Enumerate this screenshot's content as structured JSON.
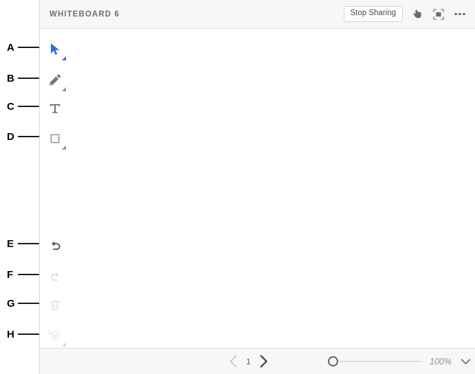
{
  "header": {
    "title": "WHITEBOARD 6",
    "stop_sharing_label": "Stop Sharing",
    "icons": {
      "pointer_hand": "hand-pointer-icon",
      "fit_screen": "fit-to-screen-icon",
      "overflow_menu": "more-options-icon"
    }
  },
  "annotations": [
    {
      "letter": "A",
      "target": "selection-tool"
    },
    {
      "letter": "B",
      "target": "pencil-tool"
    },
    {
      "letter": "C",
      "target": "text-tool"
    },
    {
      "letter": "D",
      "target": "shape-tool"
    },
    {
      "letter": "E",
      "target": "undo-button"
    },
    {
      "letter": "F",
      "target": "redo-button"
    },
    {
      "letter": "G",
      "target": "delete-button"
    },
    {
      "letter": "H",
      "target": "layers-button"
    }
  ],
  "toolbar": {
    "tools": [
      {
        "name": "selection-tool",
        "icon": "cursor-arrow-icon",
        "state": "active",
        "has_flyout": true
      },
      {
        "name": "pencil-tool",
        "icon": "pencil-icon",
        "state": "enabled",
        "has_flyout": true
      },
      {
        "name": "text-tool",
        "icon": "text-t-icon",
        "state": "enabled",
        "has_flyout": false
      },
      {
        "name": "shape-tool",
        "icon": "square-outline-icon",
        "state": "enabled",
        "has_flyout": true
      }
    ],
    "actions": [
      {
        "name": "undo-button",
        "icon": "undo-arrow-icon",
        "state": "enabled",
        "has_flyout": false
      },
      {
        "name": "redo-button",
        "icon": "redo-arrow-icon",
        "state": "disabled",
        "has_flyout": false
      },
      {
        "name": "delete-button",
        "icon": "trash-icon",
        "state": "disabled",
        "has_flyout": false
      },
      {
        "name": "layers-button",
        "icon": "layers-icon",
        "state": "disabled",
        "has_flyout": true
      }
    ]
  },
  "statusbar": {
    "page_number": "1",
    "prev_page_state": "disabled",
    "next_page_state": "enabled",
    "zoom_level": "100%",
    "zoom_slider_position_percent": 0
  },
  "colors": {
    "accent_blue": "#2b6fe0",
    "header_bg": "#f7f7f7",
    "canvas_bg": "#ffffff",
    "icon_gray": "#6b6b6b",
    "disabled_gray": "#dcdcdc"
  }
}
